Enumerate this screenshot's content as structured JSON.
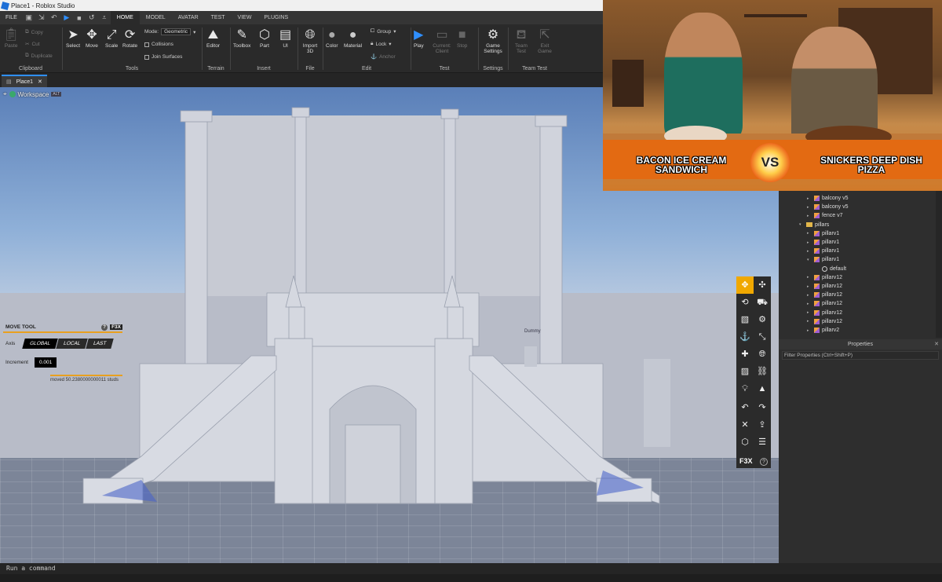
{
  "window": {
    "title": "Place1 - Roblox Studio"
  },
  "menu": {
    "file": "FILE",
    "tabs": [
      "HOME",
      "MODEL",
      "AVATAR",
      "TEST",
      "VIEW",
      "PLUGINS"
    ],
    "active_tab": "HOME"
  },
  "ribbon": {
    "clipboard": {
      "label": "Clipboard",
      "paste": "Paste",
      "copy": "Copy",
      "cut": "Cut",
      "duplicate": "Duplicate"
    },
    "tools": {
      "label": "Tools",
      "select": "Select",
      "move": "Move",
      "scale": "Scale",
      "rotate": "Rotate",
      "mode_label": "Mode:",
      "mode_value": "Geometric",
      "collisions": "Collisions",
      "join_surfaces": "Join Surfaces"
    },
    "terrain": {
      "label": "Terrain",
      "editor": "Editor"
    },
    "insert": {
      "label": "Insert",
      "toolbox": "Toolbox",
      "part": "Part",
      "ui": "UI"
    },
    "file": {
      "label": "File",
      "import3d": "Import 3D"
    },
    "edit": {
      "label": "Edit",
      "color": "Color",
      "material": "Material",
      "group": "Group",
      "lock": "Lock",
      "anchor": "Anchor"
    },
    "test": {
      "label": "Test",
      "play": "Play",
      "current_client": "Current: Client",
      "stop": "Stop"
    },
    "settings": {
      "label": "Settings",
      "game_settings": "Game Settings"
    },
    "team_test": {
      "label": "Team Test",
      "team_test": "Team Test",
      "exit_game": "Exit Game"
    }
  },
  "doc_tab": {
    "name": "Place1",
    "close": "✕"
  },
  "viewport": {
    "workspace_label": "Workspace",
    "badge": "ALT",
    "dummy_label": "Dummy"
  },
  "move_tool": {
    "title": "MOVE TOOL",
    "brand": "F3X",
    "help": "?",
    "axis_label": "Axis",
    "axes": [
      "GLOBAL",
      "LOCAL",
      "LAST"
    ],
    "active_axis": "GLOBAL",
    "increment_label": "Increment",
    "increment_value": "0.001",
    "moved_text": "moved 50.2380000000011 studs"
  },
  "f3x_toolbar": {
    "brand": "F3X",
    "help": "?"
  },
  "webcam": {
    "left_title": "BACON ICE CREAM SANDWICH",
    "vs": "VS",
    "right_title": "SNICKERS DEEP DISH PIZZA"
  },
  "explorer": {
    "rows": [
      {
        "label": "balcony v5",
        "indent": 2,
        "icon": "cube",
        "arrow": "▸"
      },
      {
        "label": "balcony v5",
        "indent": 2,
        "icon": "cube",
        "arrow": "▸"
      },
      {
        "label": "fence v7",
        "indent": 2,
        "icon": "cube",
        "arrow": "▸"
      },
      {
        "label": "pillars",
        "indent": 1,
        "icon": "folder",
        "arrow": "▾"
      },
      {
        "label": "pillarv1",
        "indent": 2,
        "icon": "cube",
        "arrow": "▸"
      },
      {
        "label": "pillarv1",
        "indent": 2,
        "icon": "cube",
        "arrow": "▸"
      },
      {
        "label": "pillarv1",
        "indent": 2,
        "icon": "cube",
        "arrow": "▸"
      },
      {
        "label": "pillarv1",
        "indent": 2,
        "icon": "cube",
        "arrow": "▾"
      },
      {
        "label": "default",
        "indent": 3,
        "icon": "globe",
        "arrow": ""
      },
      {
        "label": "pillarv12",
        "indent": 2,
        "icon": "cube",
        "arrow": "▸"
      },
      {
        "label": "pillarv12",
        "indent": 2,
        "icon": "cube",
        "arrow": "▸"
      },
      {
        "label": "pillarv12",
        "indent": 2,
        "icon": "cube",
        "arrow": "▸"
      },
      {
        "label": "pillarv12",
        "indent": 2,
        "icon": "cube",
        "arrow": "▸"
      },
      {
        "label": "pillarv12",
        "indent": 2,
        "icon": "cube",
        "arrow": "▸"
      },
      {
        "label": "pillarv12",
        "indent": 2,
        "icon": "cube",
        "arrow": "▸"
      },
      {
        "label": "pillarv2",
        "indent": 2,
        "icon": "cube",
        "arrow": "▸"
      }
    ]
  },
  "properties": {
    "title": "Properties",
    "filter_placeholder": "Filter Properties (Ctrl+Shift+P)"
  },
  "command_bar": {
    "placeholder": "Run a command"
  },
  "colors": {
    "accent": "#2f8fff",
    "f3x_active": "#f0a800",
    "banner": "#e36a12"
  }
}
